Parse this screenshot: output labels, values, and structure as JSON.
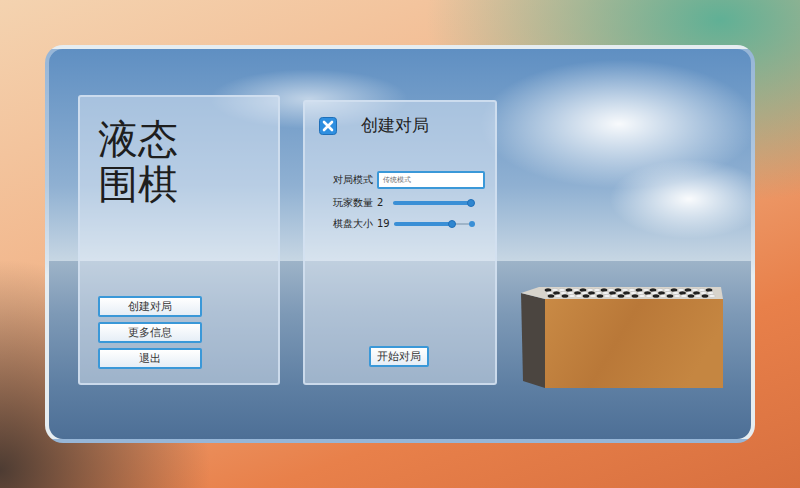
{
  "game": {
    "title": "液态围棋"
  },
  "main_menu": {
    "buttons": [
      {
        "label": "创建对局"
      },
      {
        "label": "更多信息"
      },
      {
        "label": "退出"
      }
    ]
  },
  "dialog": {
    "title": "创建对局",
    "fields": [
      {
        "kind": "select",
        "label": "对局模式",
        "value": "传统模式"
      },
      {
        "kind": "slider",
        "label": "玩家数量",
        "reading": "2",
        "level": 1
      },
      {
        "kind": "slider",
        "label": "棋盘大小",
        "reading": "19",
        "level": 0.75
      }
    ],
    "start_button": "开始对局"
  }
}
